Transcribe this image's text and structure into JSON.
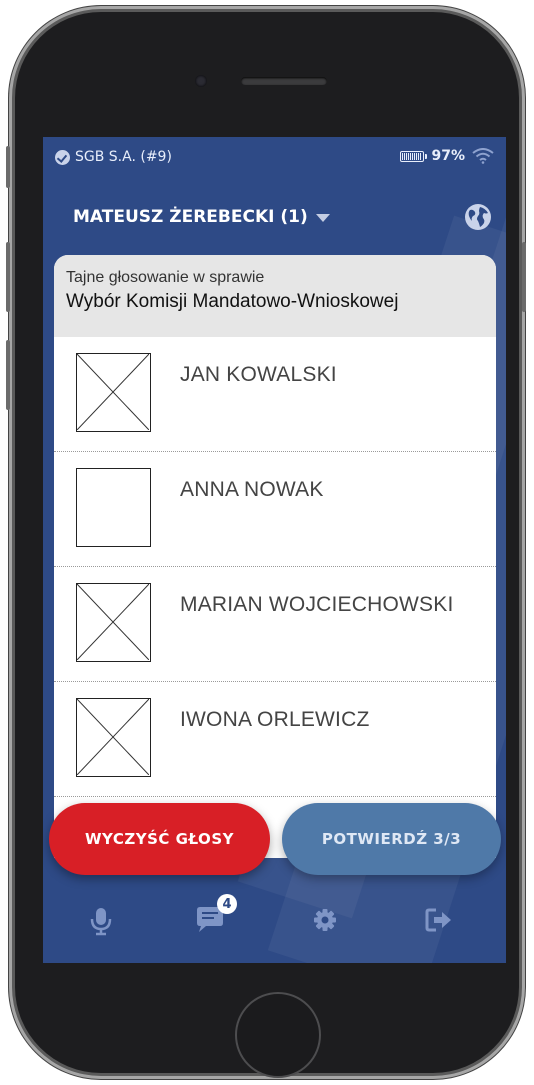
{
  "status_bar": {
    "carrier": "SGB S.A. (#9)",
    "battery": "97%"
  },
  "header": {
    "user_name": "MATEUSZ ŻEREBECKI (1)"
  },
  "vote": {
    "subtitle": "Tajne głosowanie w sprawie",
    "title": "Wybór Komisji Mandatowo-Wnioskowej",
    "candidates": [
      {
        "name": "JAN KOWALSKI",
        "checked": true
      },
      {
        "name": "ANNA NOWAK",
        "checked": false
      },
      {
        "name": "MARIAN WOJCIECHOWSKI",
        "checked": true
      },
      {
        "name": "IWONA ORLEWICZ",
        "checked": true
      }
    ]
  },
  "actions": {
    "clear_label": "WYCZYŚĆ GŁOSY",
    "confirm_label": "POTWIERDŹ 3/3"
  },
  "tabbar": {
    "items": [
      {
        "icon": "microphone-icon"
      },
      {
        "icon": "chat-icon",
        "badge": "4"
      },
      {
        "icon": "gear-icon"
      },
      {
        "icon": "logout-icon"
      }
    ]
  },
  "colors": {
    "app_background": "#2e4a86",
    "clear_button": "#d81f26",
    "confirm_button": "#4f79a8",
    "card_header": "#e6e6e6"
  }
}
